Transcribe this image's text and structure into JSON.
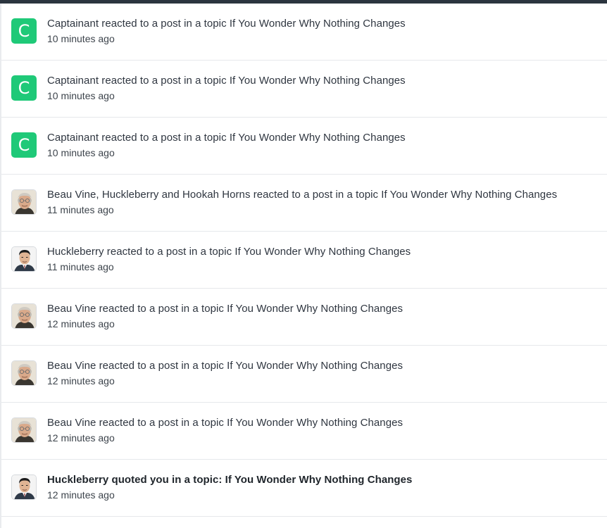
{
  "notifications": [
    {
      "avatar": {
        "type": "letter",
        "letter": "C",
        "color": "#1fc978"
      },
      "text": "Captainant reacted to a post in a topic If You Wonder Why Nothing Changes",
      "time": "10 minutes ago",
      "unread_bold": false
    },
    {
      "avatar": {
        "type": "letter",
        "letter": "C",
        "color": "#1fc978"
      },
      "text": "Captainant reacted to a post in a topic If You Wonder Why Nothing Changes",
      "time": "10 minutes ago",
      "unread_bold": false
    },
    {
      "avatar": {
        "type": "letter",
        "letter": "C",
        "color": "#1fc978"
      },
      "text": "Captainant reacted to a post in a topic If You Wonder Why Nothing Changes",
      "time": "10 minutes ago",
      "unread_bold": false
    },
    {
      "avatar": {
        "type": "photo",
        "icon": "user-photo-elder-icon"
      },
      "text": "Beau Vine, Huckleberry and Hookah Horns reacted to a post in a topic If You Wonder Why Nothing Changes",
      "time": "11 minutes ago",
      "unread_bold": false
    },
    {
      "avatar": {
        "type": "photo",
        "icon": "user-photo-suit-icon"
      },
      "text": "Huckleberry reacted to a post in a topic If You Wonder Why Nothing Changes",
      "time": "11 minutes ago",
      "unread_bold": false
    },
    {
      "avatar": {
        "type": "photo",
        "icon": "user-photo-elder-icon"
      },
      "text": "Beau Vine reacted to a post in a topic If You Wonder Why Nothing Changes",
      "time": "12 minutes ago",
      "unread_bold": false
    },
    {
      "avatar": {
        "type": "photo",
        "icon": "user-photo-elder-icon"
      },
      "text": "Beau Vine reacted to a post in a topic If You Wonder Why Nothing Changes",
      "time": "12 minutes ago",
      "unread_bold": false
    },
    {
      "avatar": {
        "type": "photo",
        "icon": "user-photo-elder-icon"
      },
      "text": "Beau Vine reacted to a post in a topic If You Wonder Why Nothing Changes",
      "time": "12 minutes ago",
      "unread_bold": false
    },
    {
      "avatar": {
        "type": "photo",
        "icon": "user-photo-suit-icon"
      },
      "text": "Huckleberry quoted you in a topic: If You Wonder Why Nothing Changes",
      "time": "12 minutes ago",
      "unread_bold": true
    }
  ]
}
